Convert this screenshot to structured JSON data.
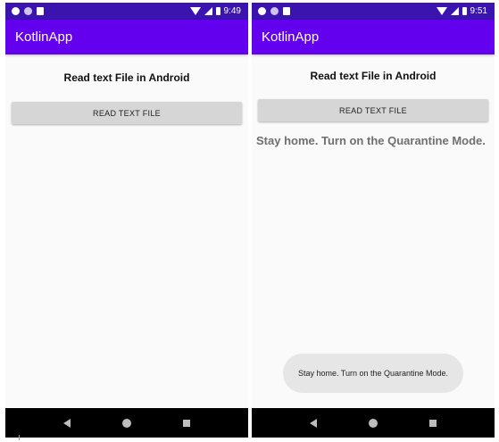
{
  "left_screen": {
    "status": {
      "time": "9:49"
    },
    "app_title": "KotlinApp",
    "heading": "Read text File in Android",
    "button_label": "READ TEXT FILE"
  },
  "right_screen": {
    "status": {
      "time": "9:51"
    },
    "app_title": "KotlinApp",
    "heading": "Read text File in Android",
    "button_label": "READ TEXT FILE",
    "result_text": "Stay home. Turn on the Quarantine Mode.",
    "toast_text": "Stay home. Turn on the Quarantine Mode."
  },
  "colors": {
    "status_bar": "#3b14b0",
    "app_bar": "#6300ee",
    "button": "#d6d6d6",
    "nav_bar": "#000000"
  },
  "icons": {
    "status_left": [
      "cast-icon",
      "dot-icon",
      "sd-card-icon"
    ],
    "status_right": [
      "wifi-icon",
      "signal-icon",
      "battery-icon"
    ],
    "nav": [
      "back-icon",
      "home-icon",
      "recents-icon"
    ]
  }
}
